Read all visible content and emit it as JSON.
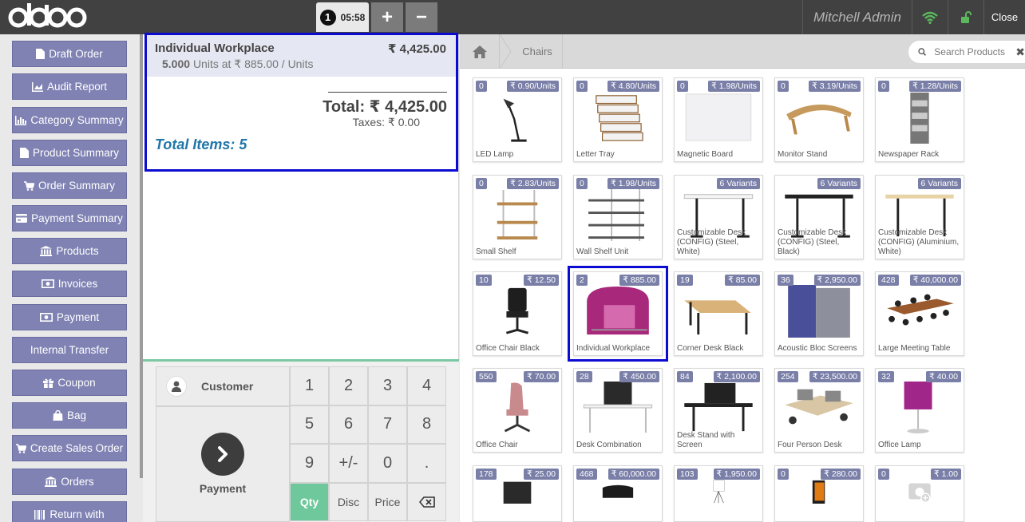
{
  "app": {
    "logo_text": "odoo",
    "order_number": "1",
    "order_time": "05:58",
    "add_order_label": "+",
    "remove_order_label": "−",
    "user_name": "Mitchell Admin",
    "close_label": "Close",
    "wifi_icon": "wifi-icon",
    "lock_icon": "unlock-icon",
    "wifi_color": "#5cb85c"
  },
  "controls": [
    {
      "label": "Draft Order",
      "icon": "file-icon"
    },
    {
      "label": "Audit Report",
      "icon": "chart-icon"
    },
    {
      "label": "Category Summary",
      "icon": "bar-chart-icon"
    },
    {
      "label": "Product Summary",
      "icon": "file-icon"
    },
    {
      "label": "Order Summary",
      "icon": "cart-icon"
    },
    {
      "label": "Payment Summary",
      "icon": "credit-card-icon"
    },
    {
      "label": "Products",
      "icon": "bank-icon"
    },
    {
      "label": "Invoices",
      "icon": "money-icon"
    },
    {
      "label": "Payment",
      "icon": "money-icon"
    },
    {
      "label": "Internal Transfer",
      "icon": ""
    },
    {
      "label": "Coupon",
      "icon": "gift-icon"
    },
    {
      "label": "Bag",
      "icon": "bag-icon"
    },
    {
      "label": "Create Sales Order",
      "icon": "cart-icon"
    },
    {
      "label": "Orders",
      "icon": "bank-icon"
    },
    {
      "label": "Return with",
      "icon": "barcode-icon"
    }
  ],
  "order": {
    "line": {
      "name": "Individual Workplace",
      "price": "₹ 4,425.00",
      "quantity": "5.000",
      "unit_detail": "Units at ₹ 885.00 / Units"
    },
    "total": "Total: ₹ 4,425.00",
    "taxes": "Taxes: ₹ 0.00",
    "total_items": "Total Items: 5"
  },
  "actionpad": {
    "customer_label": "Customer",
    "payment_label": "Payment"
  },
  "numpad": [
    "1",
    "2",
    "3",
    "4",
    "5",
    "6",
    "7",
    "8",
    "9",
    "+/-",
    "0",
    ".",
    "Qty",
    "Disc",
    "Price",
    "⌫"
  ],
  "numpad_active": "Qty",
  "breadcrumb": {
    "home_icon": "home-icon",
    "category": "Chairs"
  },
  "search": {
    "placeholder": "Search Products",
    "clear": "✖"
  },
  "products": [
    {
      "name": "LED Lamp",
      "qty": "0",
      "price": "₹ 0.90/Units"
    },
    {
      "name": "Letter Tray",
      "qty": "0",
      "price": "₹ 4.80/Units"
    },
    {
      "name": "Magnetic Board",
      "qty": "0",
      "price": "₹ 1.98/Units"
    },
    {
      "name": "Monitor Stand",
      "qty": "0",
      "price": "₹ 3.19/Units"
    },
    {
      "name": "Newspaper Rack",
      "qty": "0",
      "price": "₹ 1.28/Units"
    },
    {
      "name": "Small Shelf",
      "qty": "0",
      "price": "₹ 2.83/Units"
    },
    {
      "name": "Wall Shelf Unit",
      "qty": "0",
      "price": "₹ 1.98/Units"
    },
    {
      "name": "Customizable Desk (CONFIG) (Steel, White)",
      "qty": "",
      "price": "6 Variants"
    },
    {
      "name": "Customizable Desk (CONFIG) (Steel, Black)",
      "qty": "",
      "price": "6 Variants"
    },
    {
      "name": "Customizable Desk (CONFIG) (Aluminium, White)",
      "qty": "",
      "price": "6 Variants"
    },
    {
      "name": "Office Chair Black",
      "qty": "10",
      "price": "₹ 12.50"
    },
    {
      "name": "Individual Workplace",
      "qty": "2",
      "price": "₹ 885.00"
    },
    {
      "name": "Corner Desk Black",
      "qty": "19",
      "price": "₹ 85.00"
    },
    {
      "name": "Acoustic Bloc Screens",
      "qty": "36",
      "price": "₹ 2,950.00"
    },
    {
      "name": "Large Meeting Table",
      "qty": "428",
      "price": "₹ 40,000.00"
    },
    {
      "name": "Office Chair",
      "qty": "550",
      "price": "₹ 70.00"
    },
    {
      "name": "Desk Combination",
      "qty": "28",
      "price": "₹ 450.00"
    },
    {
      "name": "Desk Stand with Screen",
      "qty": "84",
      "price": "₹ 2,100.00"
    },
    {
      "name": "Four Person Desk",
      "qty": "254",
      "price": "₹ 23,500.00"
    },
    {
      "name": "Office Lamp",
      "qty": "32",
      "price": "₹ 40.00"
    },
    {
      "name": "",
      "qty": "178",
      "price": "₹ 25.00"
    },
    {
      "name": "",
      "qty": "468",
      "price": "₹ 60,000.00"
    },
    {
      "name": "",
      "qty": "103",
      "price": "₹ 1,950.00"
    },
    {
      "name": "",
      "qty": "0",
      "price": "₹ 280.00"
    },
    {
      "name": "",
      "qty": "0",
      "price": "₹ 1.00"
    }
  ],
  "selected_product": "Individual Workplace",
  "colors": {
    "accent_purple": "#7f82b3",
    "badge": "#7a7fa8",
    "selection_outline": "#0b0bd1",
    "qty_active": "#6ec89b",
    "total_items": "#2175a9"
  }
}
